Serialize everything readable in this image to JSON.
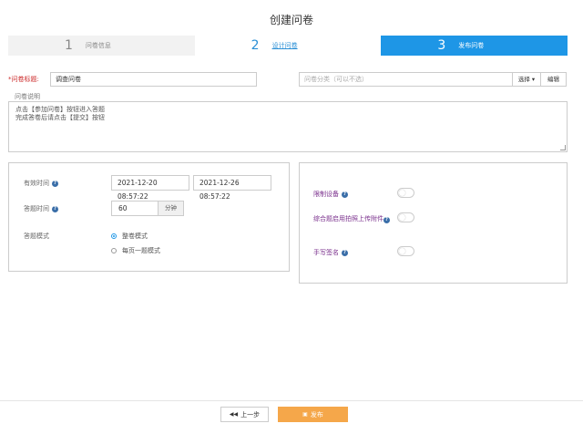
{
  "page": {
    "title": "创建问卷"
  },
  "steps": [
    {
      "num": "1",
      "label": "问卷信息"
    },
    {
      "num": "2",
      "label": "设计问卷"
    },
    {
      "num": "3",
      "label": "发布问卷"
    }
  ],
  "form": {
    "title_label": "*问卷标题:",
    "title_value": "调查问卷",
    "category_placeholder": "问卷分类（可以不选）",
    "category_select": "选择",
    "category_edit": "编辑",
    "desc_label": "问卷说明",
    "desc_lines": [
      "点击【参加问卷】按钮进入答题",
      "完成答卷后请点击【提交】按钮"
    ]
  },
  "settings": {
    "valid_time_label": "有效时间",
    "start_time": "2021-12-20 08:57:22",
    "end_time": "2021-12-26 08:57:22",
    "answer_time_label": "答题时间",
    "answer_time_value": "60",
    "answer_time_unit": "分钟",
    "mode_label": "答题模式",
    "mode_options": [
      "整卷模式",
      "每页一题模式"
    ],
    "mode_selected": 0
  },
  "toggles": [
    {
      "label": "限制设备",
      "on": false
    },
    {
      "label": "综合题启用拍照上传附件",
      "on": false
    },
    {
      "label": "手写签名",
      "on": false
    }
  ],
  "footer": {
    "prev_label": "上一步",
    "publish_label": "发布"
  },
  "colors": {
    "accent": "#1e96e6",
    "publish": "#f5a74a",
    "required": "#cc2b2b",
    "toggle_label": "#7a2f8c"
  }
}
